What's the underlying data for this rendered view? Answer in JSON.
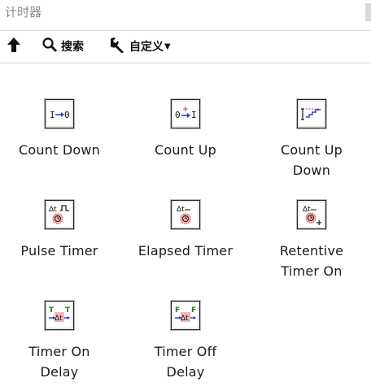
{
  "window": {
    "title": "计时器"
  },
  "toolbar": {
    "search_label": "搜索",
    "custom_label": "自定义"
  },
  "palette": {
    "items": [
      {
        "name": "count-down",
        "lines": [
          "Count Down"
        ]
      },
      {
        "name": "count-up",
        "lines": [
          "Count Up"
        ]
      },
      {
        "name": "count-up-down",
        "lines": [
          "Count Up",
          "Down"
        ]
      },
      {
        "name": "pulse-timer",
        "lines": [
          "Pulse Timer"
        ]
      },
      {
        "name": "elapsed-timer",
        "lines": [
          "Elapsed Timer"
        ]
      },
      {
        "name": "retentive-timer-on",
        "lines": [
          "Retentive",
          "Timer On"
        ]
      },
      {
        "name": "timer-on-delay",
        "lines": [
          "Timer On",
          "Delay"
        ]
      },
      {
        "name": "timer-off-delay",
        "lines": [
          "Timer Off",
          "Delay"
        ]
      }
    ]
  },
  "colors": {
    "accent_red": "#e03030",
    "accent_blue": "#1e40d0",
    "accent_green": "#1a7a1a",
    "timer_pink": "#f4b6b6"
  }
}
